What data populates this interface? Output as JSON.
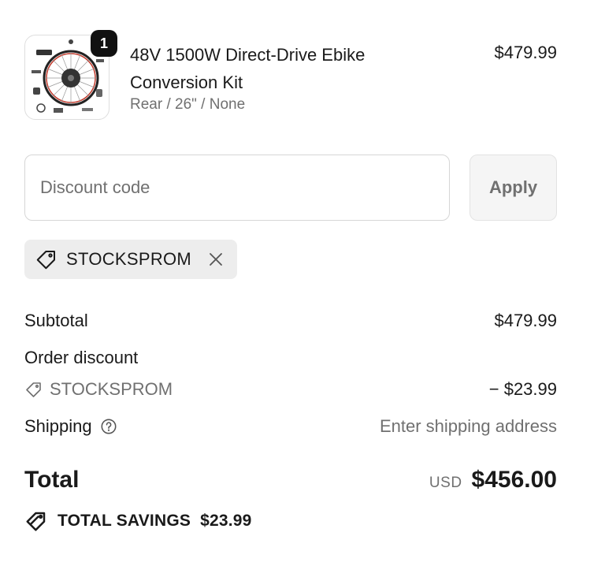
{
  "line_item": {
    "quantity": "1",
    "title": "48V 1500W Direct-Drive Ebike Conversion Kit",
    "variant": "Rear / 26\" / None",
    "price": "$479.99",
    "thumbnail_icon": "ebike-wheel-kit-image"
  },
  "discount": {
    "placeholder": "Discount code",
    "apply_label": "Apply",
    "applied_code": "STOCKSPROM",
    "tag_icon": "tag-icon",
    "remove_icon": "close-icon"
  },
  "summary": {
    "subtotal_label": "Subtotal",
    "subtotal_value": "$479.99",
    "order_discount_label": "Order discount",
    "order_discount_code": "STOCKSPROM",
    "order_discount_value": "− $23.99",
    "shipping_label": "Shipping",
    "shipping_help_icon": "help-circle-icon",
    "shipping_value": "Enter shipping address",
    "total_label": "Total",
    "currency": "USD",
    "total_value": "$456.00",
    "savings_label": "TOTAL SAVINGS",
    "savings_value": "$23.99"
  }
}
